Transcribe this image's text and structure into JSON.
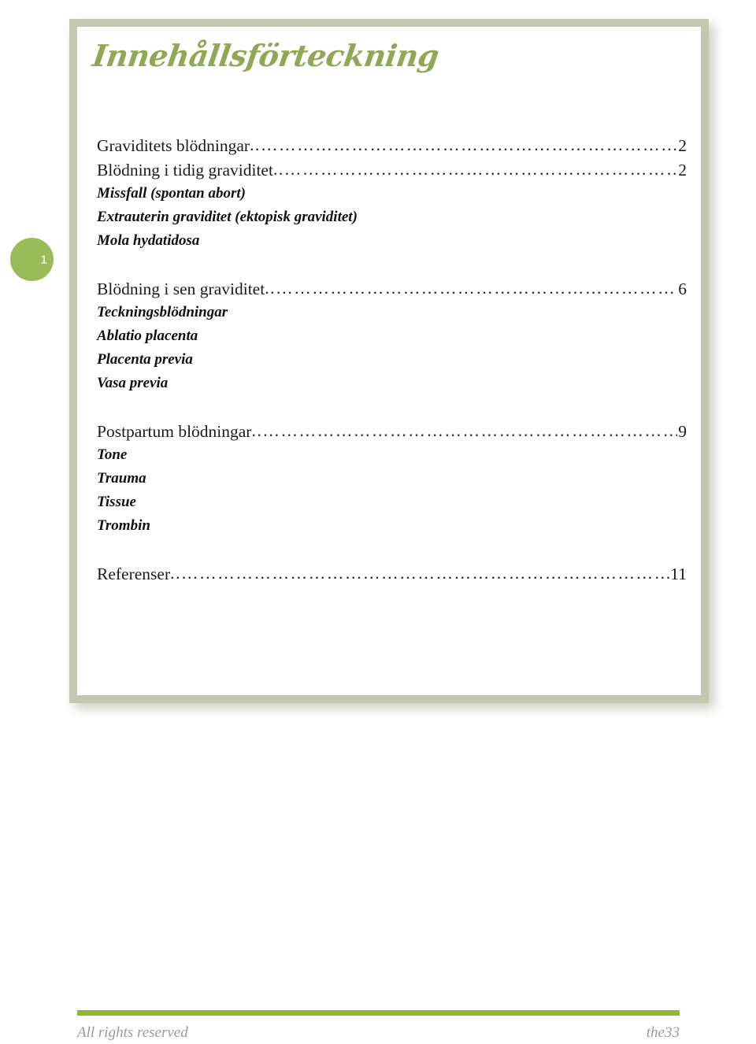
{
  "document": {
    "title": "Innehållsförteckning",
    "page_badge": "1",
    "accent_green": "#9bbb59",
    "frame_green": "#c2c8af",
    "title_green": "#8fa855",
    "rule_green": "#8cb832"
  },
  "toc": {
    "groups": [
      {
        "entries": [
          {
            "label": "Graviditets blödningar",
            "leader": "..………………………………………………………………………..",
            "page": "2"
          },
          {
            "label": "Blödning i tidig graviditet",
            "leader": "..……………………………………………………………………………...",
            "page": "2"
          }
        ],
        "subitems": [
          "Missfall (spontan abort)",
          "Extrauterin graviditet (ektopisk graviditet)",
          "Mola hydatidosa"
        ]
      },
      {
        "entries": [
          {
            "label": "Blödning i sen graviditet",
            "leader": "..…………………………………………………………………………….",
            "page": "6"
          }
        ],
        "subitems": [
          "Teckningsblödningar",
          "Ablatio placenta",
          "Placenta previa",
          "Vasa previa"
        ]
      },
      {
        "entries": [
          {
            "label": "Postpartum blödningar",
            "leader": "..……………………………………………………………………...",
            "page": "9"
          }
        ],
        "subitems": [
          "Tone",
          "Trauma",
          "Tissue",
          "Trombin"
        ]
      },
      {
        "entries": [
          {
            "label": "Referenser",
            "leader": "..……………………………………………………………………………..",
            "page": "11"
          }
        ],
        "subitems": []
      }
    ]
  },
  "footer": {
    "left": "All rights reserved",
    "right": "the33"
  }
}
